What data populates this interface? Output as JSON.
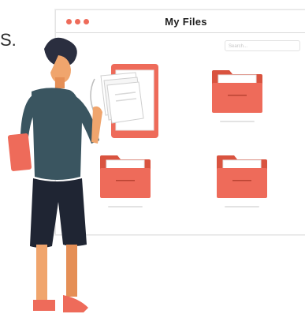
{
  "stray_text": "S.",
  "window": {
    "title": "My  Files",
    "search_placeholder": "Search..."
  },
  "colors": {
    "accent": "#ee6b5a",
    "folder_dark": "#d9533f",
    "shirt": "#3a5560",
    "hair": "#2a2e3f"
  },
  "folders": [
    {
      "name": "folder-open",
      "state": "open"
    },
    {
      "name": "folder-top-right",
      "state": "closed"
    },
    {
      "name": "folder-bottom-left",
      "state": "closed"
    },
    {
      "name": "folder-bottom-right",
      "state": "closed"
    }
  ]
}
